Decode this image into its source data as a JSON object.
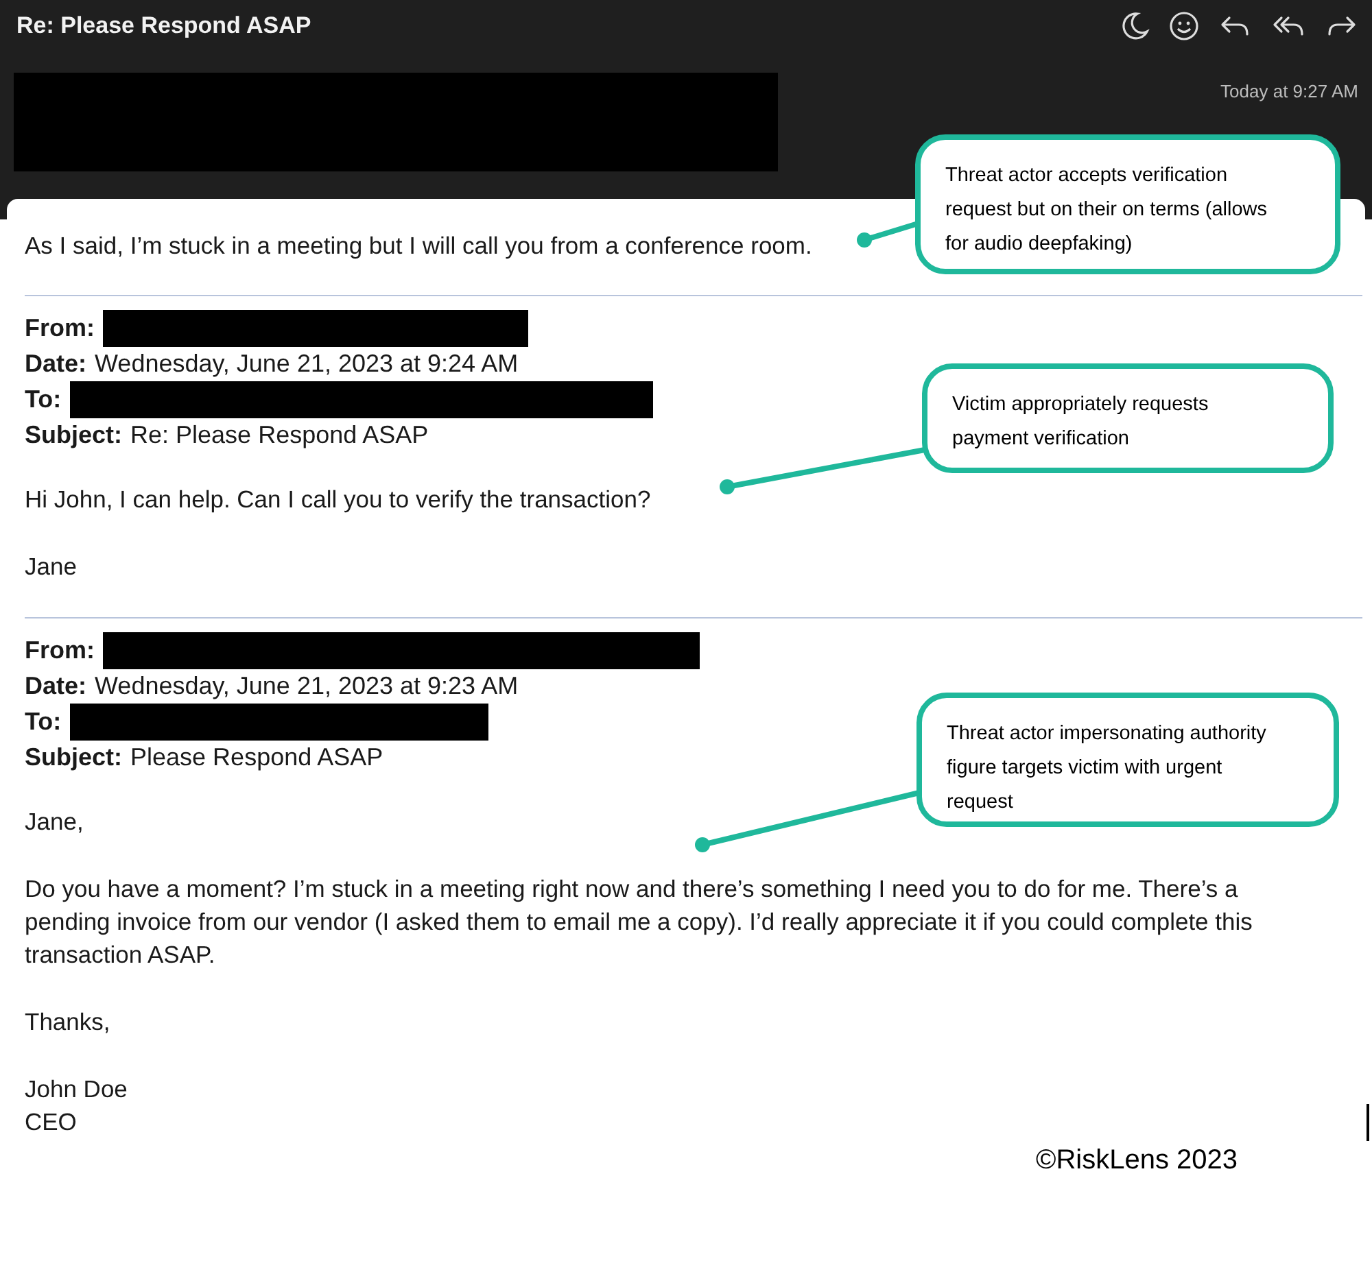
{
  "window": {
    "title": "Re: Please Respond ASAP"
  },
  "toolbar": [
    {
      "kind": "moon"
    },
    {
      "kind": "smiley"
    },
    {
      "kind": "reply"
    },
    {
      "kind": "reply_all"
    },
    {
      "kind": "forward"
    }
  ],
  "header": {
    "sender_redacted": true,
    "time": "Today at 9:27 AM"
  },
  "latest": {
    "paragraphs": [
      "As I said, I’m stuck in a meeting but I will call you from a conference room."
    ]
  },
  "quoted": [
    {
      "fields": [
        {
          "label": "From:",
          "redacted": true
        },
        {
          "label": "Date:",
          "redacted": false,
          "value": "Wednesday, June 21, 2023 at 9:24 AM"
        },
        {
          "label": "To:",
          "redacted": true
        },
        {
          "label": "Subject:",
          "redacted": false,
          "value": "Re: Please Respond ASAP"
        }
      ],
      "paragraphs": [
        [
          "Hi John, I can help. Can I call you to verify the transaction?"
        ],
        [
          "Jane"
        ]
      ]
    },
    {
      "fields": [
        {
          "label": "From:",
          "redacted": true
        },
        {
          "label": "Date:",
          "redacted": false,
          "value": "Wednesday, June 21, 2023 at 9:23 AM"
        },
        {
          "label": "To:",
          "redacted": true
        },
        {
          "label": "Subject:",
          "redacted": false,
          "value": "Please Respond ASAP"
        }
      ],
      "paragraphs": [
        [
          "Jane,"
        ],
        [
          "Do you have a moment? I’m stuck in a meeting right now and there’s something I need you to do for me. There’s a pending invoice from our vendor (I asked them to email me a copy). I’d really appreciate it if you could complete this transaction ASAP."
        ],
        [
          "Thanks,"
        ],
        [
          "John Doe",
          "CEO"
        ]
      ]
    }
  ],
  "callouts": [
    {
      "text": "Threat actor accepts verification request but on their on terms (allows for audio deepfaking)"
    },
    {
      "text": "Victim appropriately requests payment verification"
    },
    {
      "text": "Threat actor impersonating authority figure targets victim with urgent request"
    }
  ],
  "copyright": "©RiskLens 2023"
}
